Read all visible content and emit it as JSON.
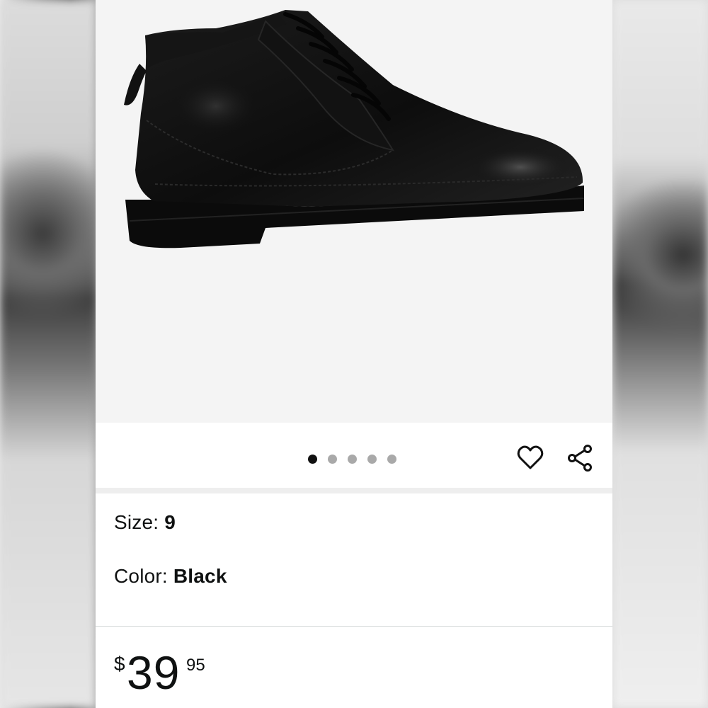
{
  "product": {
    "image_alt": "Black leather lace-up chukka boot",
    "carousel": {
      "total": 5,
      "active": 1
    },
    "icons": {
      "favorite": "heart-icon",
      "share": "share-icon"
    }
  },
  "options": {
    "size_label": "Size: ",
    "size_value": "9",
    "color_label": "Color: ",
    "color_value": "Black"
  },
  "price": {
    "symbol": "$",
    "whole": "39",
    "fraction": "95"
  },
  "colors": {
    "background": "#ffffff",
    "image_bg": "#f4f4f4",
    "dot_active": "#111111",
    "dot_inactive": "#a9a9a9",
    "text": "#0f1111"
  }
}
